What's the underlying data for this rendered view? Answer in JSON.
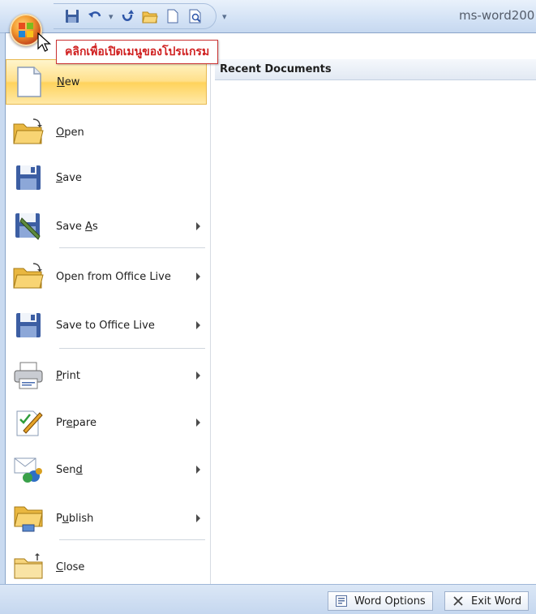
{
  "window": {
    "title": "ms-word200"
  },
  "tooltip": {
    "text": "คลิกเพื่อเปิดเมนูของโปรแกรม"
  },
  "recent": {
    "header": "Recent Documents"
  },
  "menu_items": [
    {
      "label": "New",
      "icon": "new-document-icon",
      "submenu": false,
      "highlighted": true
    },
    {
      "label": "Open",
      "icon": "open-folder-icon",
      "submenu": false
    },
    {
      "label": "Save",
      "icon": "save-disk-icon",
      "submenu": false
    },
    {
      "label": "Save As",
      "icon": "save-as-icon",
      "submenu": true
    },
    {
      "label": "Open from Office Live",
      "icon": "open-folder-icon",
      "submenu": true
    },
    {
      "label": "Save to Office Live",
      "icon": "save-disk-icon",
      "submenu": true
    },
    {
      "label": "Print",
      "icon": "printer-icon",
      "submenu": true
    },
    {
      "label": "Prepare",
      "icon": "prepare-icon",
      "submenu": true
    },
    {
      "label": "Send",
      "icon": "send-icon",
      "submenu": true
    },
    {
      "label": "Publish",
      "icon": "publish-icon",
      "submenu": true
    },
    {
      "label": "Close",
      "icon": "close-folder-icon",
      "submenu": false
    }
  ],
  "bottom_bar": {
    "word_options": "Word Options",
    "exit_word": "Exit Word"
  },
  "colors": {
    "accent_highlight": "#ffd35c",
    "tooltip_text": "#d02020",
    "frame_blue": "#c9daf0"
  }
}
